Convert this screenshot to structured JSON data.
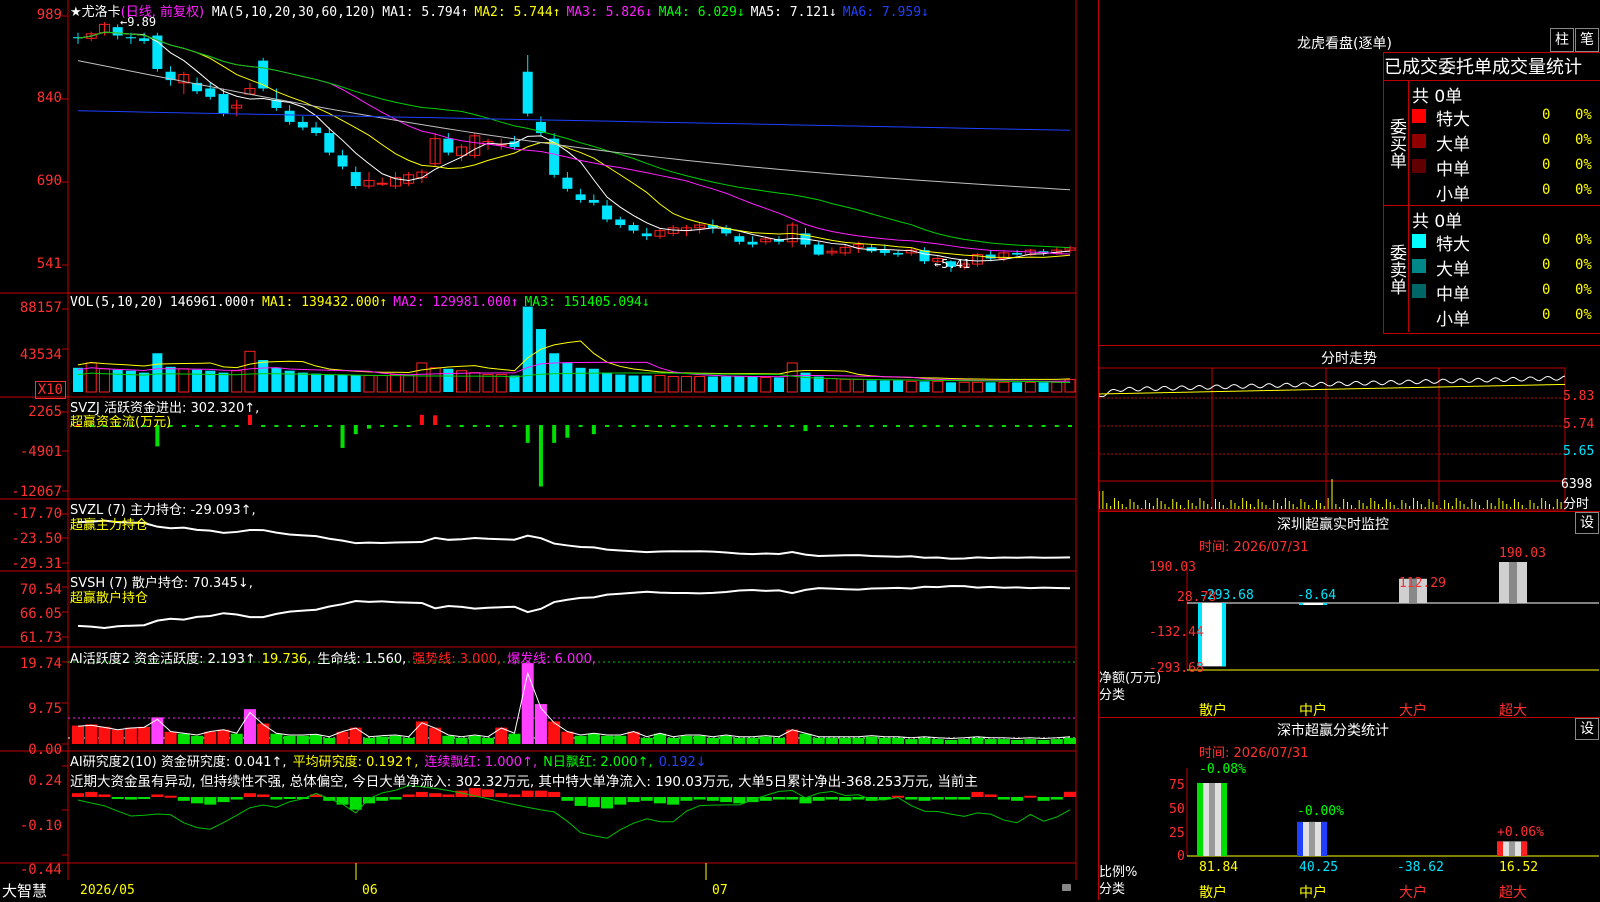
{
  "stock": {
    "name_line": "★尤洛卡",
    "period_label": "(日线, 前复权)"
  },
  "colors": {
    "up": "#ff2020",
    "down": "#00e5ff",
    "axis": "#c00000",
    "ma1": "#ffffff",
    "ma2": "#ffff00",
    "ma3": "#ff20ff",
    "ma4": "#00d000",
    "ma5": "#c0c0c0",
    "ma6": "#2040ff"
  },
  "main_panel": {
    "indicator_items": [
      {
        "text": "MA(5,10,20,30,60,120)",
        "color": "#ffffff"
      },
      {
        "text": "MA1: 5.794↑",
        "color": "#ffffff"
      },
      {
        "text": "MA2: 5.744↑",
        "color": "#ffff00"
      },
      {
        "text": "MA3: 5.826↓",
        "color": "#ff20ff"
      },
      {
        "text": "MA4: 6.029↓",
        "color": "#00ff00"
      },
      {
        "text": "MA5: 7.121↓",
        "color": "#ffffff"
      },
      {
        "text": "MA6: 7.959↓",
        "color": "#2040ff"
      }
    ],
    "y_ticks": [
      "989",
      "840",
      "690",
      "541"
    ],
    "high_label": "←9.89",
    "low_label": "←5.41"
  },
  "chart_data": [
    {
      "type": "candlestick",
      "name": "price",
      "ylim": [
        5.3,
        10.0
      ],
      "candles": [
        [
          9.62,
          9.7,
          9.5,
          9.6
        ],
        [
          9.6,
          9.72,
          9.55,
          9.68
        ],
        [
          9.7,
          9.89,
          9.65,
          9.85
        ],
        [
          9.8,
          9.85,
          9.58,
          9.65
        ],
        [
          9.62,
          9.7,
          9.5,
          9.6
        ],
        [
          9.6,
          9.7,
          9.5,
          9.55
        ],
        [
          9.65,
          9.7,
          9.0,
          9.05
        ],
        [
          9.0,
          9.1,
          8.75,
          8.85
        ],
        [
          8.8,
          9.0,
          8.6,
          8.95
        ],
        [
          8.8,
          8.9,
          8.6,
          8.65
        ],
        [
          8.7,
          8.8,
          8.5,
          8.55
        ],
        [
          8.6,
          8.7,
          8.2,
          8.25
        ],
        [
          8.35,
          8.5,
          8.2,
          8.4
        ],
        [
          8.6,
          8.8,
          8.6,
          8.7
        ],
        [
          9.2,
          9.25,
          8.65,
          8.7
        ],
        [
          8.5,
          8.7,
          8.3,
          8.35
        ],
        [
          8.3,
          8.4,
          8.05,
          8.1
        ],
        [
          8.1,
          8.2,
          7.95,
          8.0
        ],
        [
          8.0,
          8.1,
          7.85,
          7.9
        ],
        [
          7.9,
          8.0,
          7.5,
          7.55
        ],
        [
          7.5,
          7.6,
          7.25,
          7.3
        ],
        [
          7.2,
          7.3,
          6.9,
          6.95
        ],
        [
          6.95,
          7.2,
          6.9,
          7.05
        ],
        [
          7.0,
          7.1,
          6.95,
          7.0
        ],
        [
          6.95,
          7.2,
          6.9,
          7.1
        ],
        [
          7.0,
          7.2,
          6.95,
          7.15
        ],
        [
          7.1,
          7.25,
          7.0,
          7.2
        ],
        [
          7.35,
          7.9,
          7.3,
          7.8
        ],
        [
          7.8,
          7.9,
          7.5,
          7.55
        ],
        [
          7.5,
          7.7,
          7.4,
          7.65
        ],
        [
          7.5,
          7.9,
          7.45,
          7.85
        ],
        [
          7.7,
          7.8,
          7.6,
          7.75
        ],
        [
          7.7,
          7.8,
          7.6,
          7.7
        ],
        [
          7.75,
          7.85,
          7.6,
          7.65
        ],
        [
          9.0,
          9.3,
          8.2,
          8.25
        ],
        [
          8.1,
          8.2,
          7.85,
          7.9
        ],
        [
          7.8,
          7.9,
          7.1,
          7.15
        ],
        [
          7.1,
          7.2,
          6.85,
          6.9
        ],
        [
          6.8,
          6.9,
          6.65,
          6.7
        ],
        [
          6.7,
          6.8,
          6.6,
          6.65
        ],
        [
          6.6,
          6.7,
          6.3,
          6.35
        ],
        [
          6.35,
          6.4,
          6.2,
          6.25
        ],
        [
          6.25,
          6.3,
          6.1,
          6.15
        ],
        [
          6.1,
          6.2,
          5.98,
          6.05
        ],
        [
          6.05,
          6.2,
          6.0,
          6.15
        ],
        [
          6.1,
          6.25,
          6.05,
          6.2
        ],
        [
          6.15,
          6.25,
          6.05,
          6.2
        ],
        [
          6.2,
          6.3,
          6.1,
          6.25
        ],
        [
          6.25,
          6.35,
          6.1,
          6.2
        ],
        [
          6.2,
          6.25,
          6.05,
          6.1
        ],
        [
          6.05,
          6.1,
          5.9,
          5.95
        ],
        [
          5.95,
          6.05,
          5.85,
          5.9
        ],
        [
          5.95,
          6.05,
          5.9,
          6.0
        ],
        [
          6.0,
          6.05,
          5.9,
          5.95
        ],
        [
          5.95,
          6.3,
          5.85,
          6.25
        ],
        [
          6.1,
          6.2,
          5.85,
          5.9
        ],
        [
          5.9,
          5.95,
          5.7,
          5.72
        ],
        [
          5.75,
          5.85,
          5.7,
          5.78
        ],
        [
          5.75,
          5.9,
          5.7,
          5.85
        ],
        [
          5.85,
          5.95,
          5.75,
          5.9
        ],
        [
          5.85,
          5.9,
          5.75,
          5.78
        ],
        [
          5.8,
          5.9,
          5.7,
          5.75
        ],
        [
          5.75,
          5.8,
          5.68,
          5.72
        ],
        [
          5.75,
          5.85,
          5.7,
          5.8
        ],
        [
          5.8,
          5.85,
          5.55,
          5.6
        ],
        [
          5.6,
          5.7,
          5.5,
          5.65
        ],
        [
          5.6,
          5.62,
          5.41,
          5.5
        ],
        [
          5.5,
          5.6,
          5.45,
          5.55
        ],
        [
          5.55,
          5.75,
          5.5,
          5.72
        ],
        [
          5.72,
          5.8,
          5.6,
          5.65
        ],
        [
          5.65,
          5.8,
          5.6,
          5.75
        ],
        [
          5.75,
          5.8,
          5.7,
          5.72
        ],
        [
          5.72,
          5.82,
          5.7,
          5.8
        ],
        [
          5.78,
          5.82,
          5.7,
          5.75
        ],
        [
          5.75,
          5.85,
          5.72,
          5.8
        ],
        [
          5.8,
          5.88,
          5.75,
          5.84
        ]
      ]
    },
    {
      "type": "bar",
      "name": "volume",
      "ylim": [
        0,
        95000
      ],
      "values": [
        25000,
        30000,
        24000,
        23000,
        22000,
        20000,
        40000,
        26000,
        24000,
        23000,
        22000,
        20000,
        22000,
        42000,
        33000,
        25000,
        22000,
        20000,
        19000,
        18000,
        18000,
        17000,
        17000,
        17000,
        18000,
        17000,
        30000,
        25000,
        24000,
        22000,
        20000,
        18000,
        18000,
        17000,
        88157,
        65000,
        40000,
        30000,
        25000,
        24000,
        20000,
        18000,
        17000,
        17000,
        17000,
        16000,
        16000,
        16000,
        16000,
        16000,
        16000,
        16000,
        15000,
        15000,
        30000,
        20000,
        16000,
        14000,
        13000,
        13000,
        12000,
        12000,
        12000,
        11000,
        11000,
        11000,
        10000,
        10000,
        10000,
        10000,
        10000,
        10000,
        10000,
        10000,
        10000,
        13000
      ]
    },
    {
      "type": "bar",
      "name": "svzj",
      "ylim": [
        -12500,
        2800
      ],
      "values": [
        0,
        -150,
        -200,
        -100,
        -300,
        -200,
        -4200,
        -150,
        -300,
        -200,
        -150,
        -300,
        -100,
        2000,
        -200,
        -150,
        -100,
        -150,
        -150,
        -200,
        -4500,
        -1800,
        -700,
        -200,
        -150,
        -200,
        2000,
        1900,
        -100,
        -100,
        -150,
        -150,
        -100,
        -200,
        -3500,
        -12067,
        -3500,
        -2500,
        -200,
        -1800,
        -300,
        -200,
        -100,
        -150,
        -100,
        -300,
        -200,
        -150,
        -150,
        -100,
        -200,
        -250,
        -200,
        -150,
        -200,
        -1200,
        -200,
        -150,
        -100,
        -100,
        -150,
        -100,
        -150,
        -200,
        -150,
        -100,
        -100,
        -150,
        -100,
        -150,
        -150,
        -100,
        -100,
        -150,
        -150,
        -200
      ]
    },
    {
      "type": "bar",
      "name": "ai_activity",
      "ylim": [
        0,
        20.5
      ],
      "values": [
        4.5,
        4.8,
        4.2,
        3.5,
        4.0,
        4.2,
        6.5,
        3.0,
        2.5,
        2.0,
        3.0,
        3.5,
        2.5,
        8.5,
        5.0,
        2.5,
        2.0,
        2.0,
        2.2,
        1.5,
        3.0,
        4.0,
        1.5,
        1.8,
        2.0,
        1.5,
        5.5,
        4.0,
        2.0,
        1.5,
        2.0,
        1.5,
        4.0,
        2.5,
        19.74,
        9.75,
        5.5,
        3.0,
        2.0,
        2.5,
        2.0,
        2.0,
        3.0,
        1.5,
        2.5,
        1.5,
        2.0,
        2.0,
        1.5,
        2.0,
        1.5,
        1.5,
        1.8,
        1.5,
        3.5,
        2.5,
        1.5,
        1.5,
        1.5,
        1.5,
        1.8,
        1.5,
        1.5,
        1.2,
        1.5,
        1.2,
        1.0,
        1.2,
        1.5,
        1.2,
        1.2,
        1.0,
        1.2,
        1.0,
        1.2,
        1.5
      ]
    },
    {
      "type": "bar",
      "name": "ai_research",
      "ylim": [
        -0.45,
        0.25
      ],
      "values": [
        0.03,
        0.04,
        0.02,
        -0.01,
        -0.02,
        -0.01,
        0.02,
        0.01,
        -0.03,
        -0.05,
        -0.06,
        -0.04,
        -0.02,
        0.03,
        0.02,
        -0.02,
        -0.01,
        -0.01,
        0.02,
        -0.03,
        -0.06,
        -0.1,
        -0.05,
        -0.03,
        -0.02,
        0.02,
        0.04,
        0.03,
        0.02,
        0.05,
        0.07,
        0.06,
        0.03,
        0.02,
        0.05,
        0.05,
        0.04,
        -0.03,
        -0.07,
        -0.08,
        -0.09,
        -0.06,
        -0.04,
        -0.03,
        -0.05,
        -0.06,
        -0.03,
        -0.02,
        -0.03,
        -0.04,
        -0.05,
        -0.04,
        -0.03,
        -0.02,
        -0.02,
        -0.05,
        -0.03,
        -0.02,
        -0.03,
        -0.02,
        -0.03,
        -0.02,
        0.01,
        -0.02,
        -0.03,
        -0.02,
        -0.02,
        -0.02,
        0.04,
        0.02,
        -0.02,
        -0.03,
        0.01,
        -0.03,
        -0.02,
        0.041
      ]
    }
  ],
  "vol_panel": {
    "indicator_items": [
      {
        "text": "VOL(5,10,20)",
        "color": "#ffffff"
      },
      {
        "text": "146961.000↑",
        "color": "#ffffff"
      },
      {
        "text": "MA1: 139432.000↑",
        "color": "#ffff00"
      },
      {
        "text": "MA2: 129981.000↑",
        "color": "#ff20ff"
      },
      {
        "text": "MA3: 151405.094↓",
        "color": "#00ff00"
      }
    ],
    "y_ticks": [
      "88157",
      "43534"
    ],
    "unit_label": "X10"
  },
  "svzj_panel": {
    "indicator_items": [
      {
        "text": "SVZJ  活跃资金进出: 302.320↑,",
        "color": "#ffffff"
      }
    ],
    "subtitle": "超赢资金流(万元)",
    "y_ticks": [
      "2265",
      "-4901",
      "-12067"
    ]
  },
  "svzl_panel": {
    "indicator_items": [
      {
        "text": "SVZL (7) 主力持仓: -29.093↑,",
        "color": "#ffffff"
      }
    ],
    "subtitle": "超赢主力持仓",
    "y_ticks": [
      "-17.70",
      "-23.50",
      "-29.31"
    ]
  },
  "svsh_panel": {
    "indicator_items": [
      {
        "text": "SVSH (7) 散户持仓: 70.345↓,",
        "color": "#ffffff"
      }
    ],
    "subtitle": "超赢散户持仓",
    "y_ticks": [
      "70.54",
      "66.05",
      "61.73"
    ]
  },
  "ai_activity_panel": {
    "indicator_items": [
      {
        "text": "AI活跃度2 资金活跃度: 2.193↑",
        "color": "#ffffff"
      },
      {
        "text": "19.736,",
        "color": "#ffff00"
      },
      {
        "text": "生命线: 1.560,",
        "color": "#ffffff"
      },
      {
        "text": "强势线: 3.000,",
        "color": "#ff2020"
      },
      {
        "text": "爆发线: 6.000,",
        "color": "#ff20ff"
      }
    ],
    "y_ticks": [
      "19.74",
      "9.75",
      "0.00"
    ]
  },
  "ai_research_panel": {
    "indicator_items": [
      {
        "text": "AI研究度2(10) 资金研究度: 0.041↑,",
        "color": "#ffffff"
      },
      {
        "text": "平均研究度: 0.192↑,",
        "color": "#ffff00"
      },
      {
        "text": "连续飘红: 1.000↑,",
        "color": "#ff20ff"
      },
      {
        "text": "N日飘红: 2.000↑,",
        "color": "#00ff00"
      },
      {
        "text": "0.192↓",
        "color": "#2040ff"
      }
    ],
    "comment": "近期大资金虽有异动, 但持续性不强, 总体偏空, 今日大单净流入: 302.32万元, 其中特大单净流入: 190.03万元, 大单5日累计净出-368.253万元, 当前主",
    "y_ticks": [
      "0.24",
      "-0.10",
      "-0.44"
    ]
  },
  "x_axis": {
    "brand": "大智慧",
    "labels": [
      "2026/05",
      "06",
      "07"
    ]
  },
  "longhu": {
    "title": "龙虎看盘(逐单)",
    "btn_zhu": "柱",
    "btn_bi": "笔",
    "tabs_text": "已成交委托单成交量统计",
    "buy_label": "委买单",
    "sell_label": "委卖单",
    "buy_total": "共 0单",
    "sell_total": "共 0单",
    "buy_rows": [
      {
        "label": "特大",
        "count": "0",
        "pct": "0%",
        "color": "#ff0000"
      },
      {
        "label": "大单",
        "count": "0",
        "pct": "0%",
        "color": "#900000"
      },
      {
        "label": "中单",
        "count": "0",
        "pct": "0%",
        "color": "#600000"
      },
      {
        "label": "小单",
        "count": "0",
        "pct": "0%",
        "color": "#000000"
      }
    ],
    "sell_rows": [
      {
        "label": "特大",
        "count": "0",
        "pct": "0%",
        "color": "#00ffff"
      },
      {
        "label": "大单",
        "count": "0",
        "pct": "0%",
        "color": "#008888"
      },
      {
        "label": "中单",
        "count": "0",
        "pct": "0%",
        "color": "#006666"
      },
      {
        "label": "小单",
        "count": "0",
        "pct": "0%",
        "color": "#000000"
      }
    ]
  },
  "fenshi": {
    "title": "分时走势",
    "y_ticks": [
      "5.83",
      "5.74",
      "5.65"
    ],
    "vol_label": "6398",
    "bottom_label": "分时"
  },
  "monitor": {
    "title": "深圳超赢实时监控",
    "btn": "设",
    "time_label": "时间: 2026/07/31",
    "y_ticks": [
      "190.03",
      "28.78",
      "-132.44",
      "-293.68"
    ],
    "bar_values": [
      "-293.68",
      "-8.64",
      "112.29",
      "190.03"
    ],
    "values": [
      -293.68,
      -8.64,
      112.29,
      190.03
    ],
    "ylabel": "净额(万元)",
    "xlabel": "分类",
    "categories": [
      "散户",
      "中户",
      "大户",
      "超大"
    ]
  },
  "classify": {
    "title": "深市超赢分类统计",
    "btn": "设",
    "time_label": "时间: 2026/07/31",
    "y_ticks": [
      "75",
      "50",
      "25",
      "0"
    ],
    "top_labels": [
      "-0.08%",
      "-0.00%",
      "+0.06%"
    ],
    "bottom_values": [
      "81.84",
      "40.25",
      "-38.62",
      "16.52"
    ],
    "bar_heights": [
      75,
      35,
      0,
      15
    ],
    "ylabel": "比例%",
    "xlabel": "分类",
    "categories": [
      "散户",
      "中户",
      "大户",
      "超大"
    ]
  }
}
